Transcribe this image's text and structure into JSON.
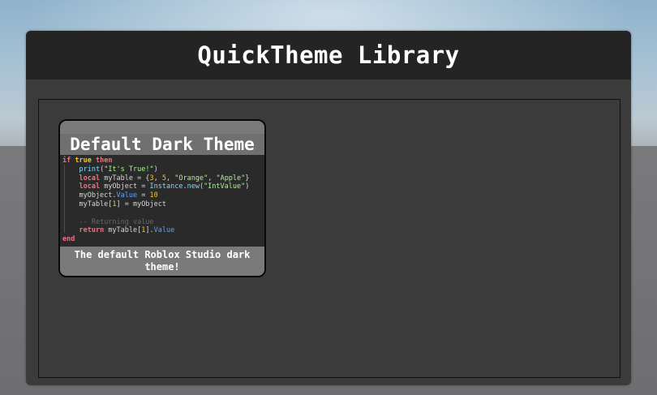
{
  "window": {
    "title": "QuickTheme Library"
  },
  "themes": [
    {
      "name": "Default Dark Theme",
      "description": "The default Roblox Studio dark theme!",
      "code_preview": [
        [
          {
            "t": "if",
            "c": "kw"
          },
          {
            "t": " ",
            "c": "txt"
          },
          {
            "t": "true",
            "c": "bool"
          },
          {
            "t": " ",
            "c": "txt"
          },
          {
            "t": "then",
            "c": "kw"
          }
        ],
        [
          {
            "t": "    ",
            "c": "txt"
          },
          {
            "t": "print",
            "c": "fn"
          },
          {
            "t": "(",
            "c": "txt"
          },
          {
            "t": "\"It's True!\"",
            "c": "str"
          },
          {
            "t": ")",
            "c": "txt"
          }
        ],
        [
          {
            "t": "    ",
            "c": "txt"
          },
          {
            "t": "local",
            "c": "kw"
          },
          {
            "t": " myTable = {",
            "c": "txt"
          },
          {
            "t": "3",
            "c": "num"
          },
          {
            "t": ", ",
            "c": "txt"
          },
          {
            "t": "5",
            "c": "num"
          },
          {
            "t": ", ",
            "c": "txt"
          },
          {
            "t": "\"Orange\"",
            "c": "str"
          },
          {
            "t": ", ",
            "c": "txt"
          },
          {
            "t": "\"Apple\"",
            "c": "str"
          },
          {
            "t": "}",
            "c": "txt"
          }
        ],
        [
          {
            "t": "    ",
            "c": "txt"
          },
          {
            "t": "local",
            "c": "kw"
          },
          {
            "t": " myObject = ",
            "c": "txt"
          },
          {
            "t": "Instance",
            "c": "fn"
          },
          {
            "t": ".",
            "c": "txt"
          },
          {
            "t": "new",
            "c": "fn"
          },
          {
            "t": "(",
            "c": "txt"
          },
          {
            "t": "\"IntValue\"",
            "c": "str"
          },
          {
            "t": ")",
            "c": "txt"
          }
        ],
        [
          {
            "t": "    myObject.",
            "c": "txt"
          },
          {
            "t": "Value",
            "c": "prop"
          },
          {
            "t": " = ",
            "c": "txt"
          },
          {
            "t": "10",
            "c": "num"
          }
        ],
        [
          {
            "t": "    myTable[",
            "c": "txt"
          },
          {
            "t": "1",
            "c": "num"
          },
          {
            "t": "] = myObject",
            "c": "txt"
          }
        ],
        [
          {
            "t": "",
            "c": "txt"
          }
        ],
        [
          {
            "t": "    ",
            "c": "txt"
          },
          {
            "t": "-- Returning value",
            "c": "com"
          }
        ],
        [
          {
            "t": "    ",
            "c": "txt"
          },
          {
            "t": "return",
            "c": "kw"
          },
          {
            "t": " myTable[",
            "c": "txt"
          },
          {
            "t": "1",
            "c": "num"
          },
          {
            "t": "].",
            "c": "txt"
          },
          {
            "t": "Value",
            "c": "prop"
          }
        ],
        [
          {
            "t": "end",
            "c": "kw"
          }
        ]
      ]
    }
  ]
}
